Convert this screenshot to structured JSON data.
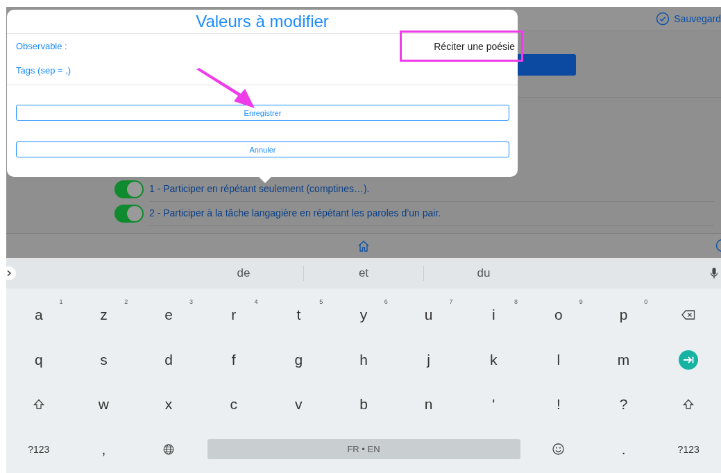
{
  "background": {
    "save_label": "Sauvegard",
    "rows": [
      {
        "label": "1 - Participer en répétant seulement (comptines…).",
        "on": true
      },
      {
        "label": "2 - Participer à la tâche langagière en répétant les paroles d’un pair.",
        "on": true
      }
    ]
  },
  "modal": {
    "title": "Valeurs à modifier",
    "fields": [
      {
        "label": "Observable :",
        "value": "Réciter une poésie",
        "highlighted": true
      },
      {
        "label": "Tags (sep = ,)"
      }
    ],
    "buttons": [
      "Enregistrer",
      "Annuler"
    ]
  },
  "keyboard": {
    "suggestions": [
      "de",
      "et",
      "du"
    ],
    "rows": [
      [
        {
          "kind": "letter",
          "label": "a",
          "hint": "1"
        },
        {
          "kind": "letter",
          "label": "z",
          "hint": "2"
        },
        {
          "kind": "letter",
          "label": "e",
          "hint": "3"
        },
        {
          "kind": "letter",
          "label": "r",
          "hint": "4"
        },
        {
          "kind": "letter",
          "label": "t",
          "hint": "5"
        },
        {
          "kind": "letter",
          "label": "y",
          "hint": "6"
        },
        {
          "kind": "letter",
          "label": "u",
          "hint": "7"
        },
        {
          "kind": "letter",
          "label": "i",
          "hint": "8"
        },
        {
          "kind": "letter",
          "label": "o",
          "hint": "9"
        },
        {
          "kind": "letter",
          "label": "p",
          "hint": "0"
        },
        {
          "kind": "backspace"
        }
      ],
      [
        {
          "kind": "letter",
          "label": "q"
        },
        {
          "kind": "letter",
          "label": "s"
        },
        {
          "kind": "letter",
          "label": "d"
        },
        {
          "kind": "letter",
          "label": "f"
        },
        {
          "kind": "letter",
          "label": "g"
        },
        {
          "kind": "letter",
          "label": "h"
        },
        {
          "kind": "letter",
          "label": "j"
        },
        {
          "kind": "letter",
          "label": "k"
        },
        {
          "kind": "letter",
          "label": "l"
        },
        {
          "kind": "letter",
          "label": "m"
        },
        {
          "kind": "enter"
        }
      ],
      [
        {
          "kind": "shift"
        },
        {
          "kind": "letter",
          "label": "w"
        },
        {
          "kind": "letter",
          "label": "x"
        },
        {
          "kind": "letter",
          "label": "c"
        },
        {
          "kind": "letter",
          "label": "v"
        },
        {
          "kind": "letter",
          "label": "b"
        },
        {
          "kind": "letter",
          "label": "n"
        },
        {
          "kind": "letter",
          "label": "'"
        },
        {
          "kind": "letter",
          "label": "!"
        },
        {
          "kind": "letter",
          "label": "?"
        },
        {
          "kind": "shift"
        }
      ]
    ],
    "bottom_row": {
      "left": [
        {
          "kind": "mode",
          "label": "?123"
        },
        {
          "kind": "letter",
          "label": ","
        },
        {
          "kind": "globe"
        }
      ],
      "space_label": "FR • EN",
      "right": [
        {
          "kind": "emoji"
        },
        {
          "kind": "letter",
          "label": "."
        },
        {
          "kind": "mode",
          "label": "?123"
        }
      ]
    }
  }
}
